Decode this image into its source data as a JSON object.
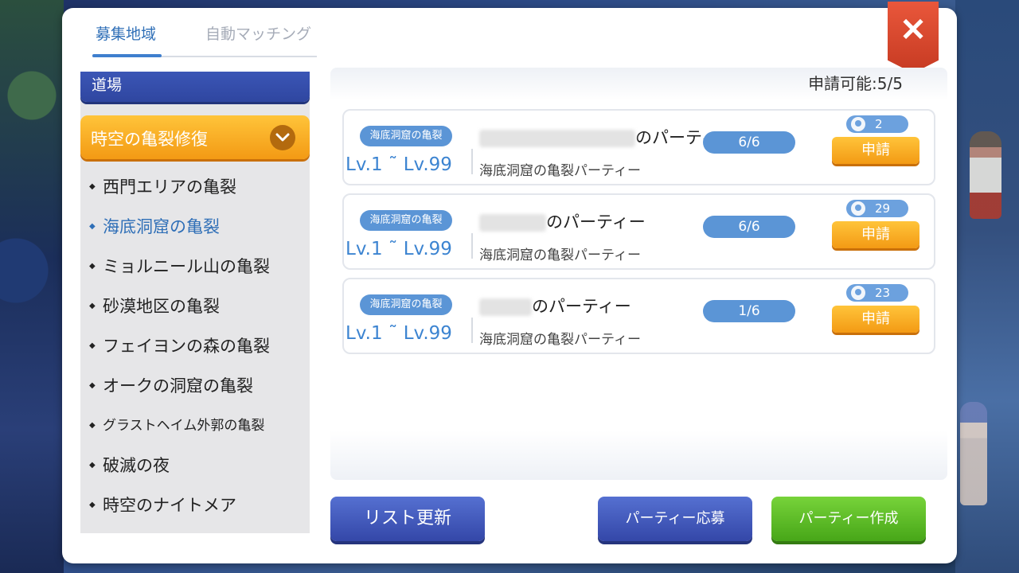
{
  "tabs": [
    {
      "label": "募集地域",
      "active": true
    },
    {
      "label": "自動マッチング",
      "active": false
    }
  ],
  "close": {
    "label": "✕"
  },
  "sidebar": {
    "top_category": "道場",
    "active_category": "時空の亀裂修復",
    "items": [
      {
        "label": "西門エリアの亀裂"
      },
      {
        "label": "海底洞窟の亀裂",
        "active": true
      },
      {
        "label": "ミョルニール山の亀裂"
      },
      {
        "label": "砂漠地区の亀裂"
      },
      {
        "label": "フェイヨンの森の亀裂"
      },
      {
        "label": "オークの洞窟の亀裂"
      },
      {
        "label": "グラストヘイム外郭の亀裂"
      },
      {
        "label": "破滅の夜"
      },
      {
        "label": "時空のナイトメア"
      }
    ]
  },
  "main": {
    "available": "申請可能:5/5",
    "parties": [
      {
        "tag": "海底洞窟の亀裂",
        "level": "Lv.1 ˜ Lv.99",
        "name_suffix": "のパーティー",
        "desc": "海底洞窟の亀裂パーティー",
        "members": "6/6",
        "badge": "2",
        "apply": "申請"
      },
      {
        "tag": "海底洞窟の亀裂",
        "level": "Lv.1 ˜ Lv.99",
        "name_suffix": "のパーティー",
        "desc": "海底洞窟の亀裂パーティー",
        "members": "6/6",
        "badge": "29",
        "apply": "申請"
      },
      {
        "tag": "海底洞窟の亀裂",
        "level": "Lv.1 ˜ Lv.99",
        "name_suffix": "のパーティー",
        "desc": "海底洞窟の亀裂パーティー",
        "members": "1/6",
        "badge": "23",
        "apply": "申請"
      }
    ]
  },
  "buttons": {
    "refresh": "リスト更新",
    "apply_party": "パーティー応募",
    "create_party": "パーティー作成"
  },
  "colors": {
    "accent": "#2f6fb7",
    "orange": "#f39a14",
    "green": "#47a618",
    "blue": "#3447a8"
  }
}
